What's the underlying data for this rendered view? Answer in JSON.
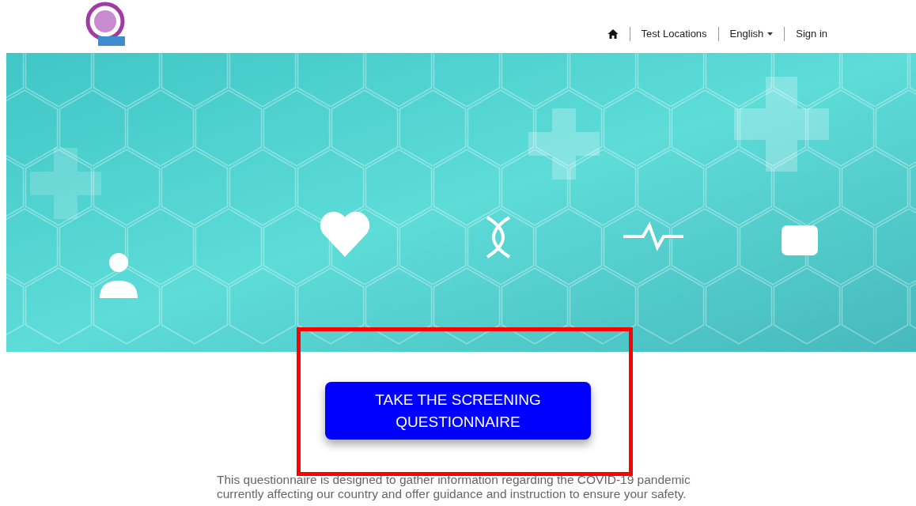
{
  "nav": {
    "items": [
      {
        "kind": "home"
      },
      {
        "kind": "link",
        "label": "Test Locations"
      },
      {
        "kind": "dropdown",
        "label": "English"
      },
      {
        "kind": "link",
        "label": "Sign in"
      }
    ]
  },
  "cta_button": {
    "label": "TAKE THE SCREENING QUESTIONNAIRE"
  },
  "description": "This questionnaire is designed to gather information regarding the COVID-19 pandemic currently affecting our country and offer guidance and instruction to ensure your safety.",
  "highlight": {
    "color": "#ff0000"
  }
}
